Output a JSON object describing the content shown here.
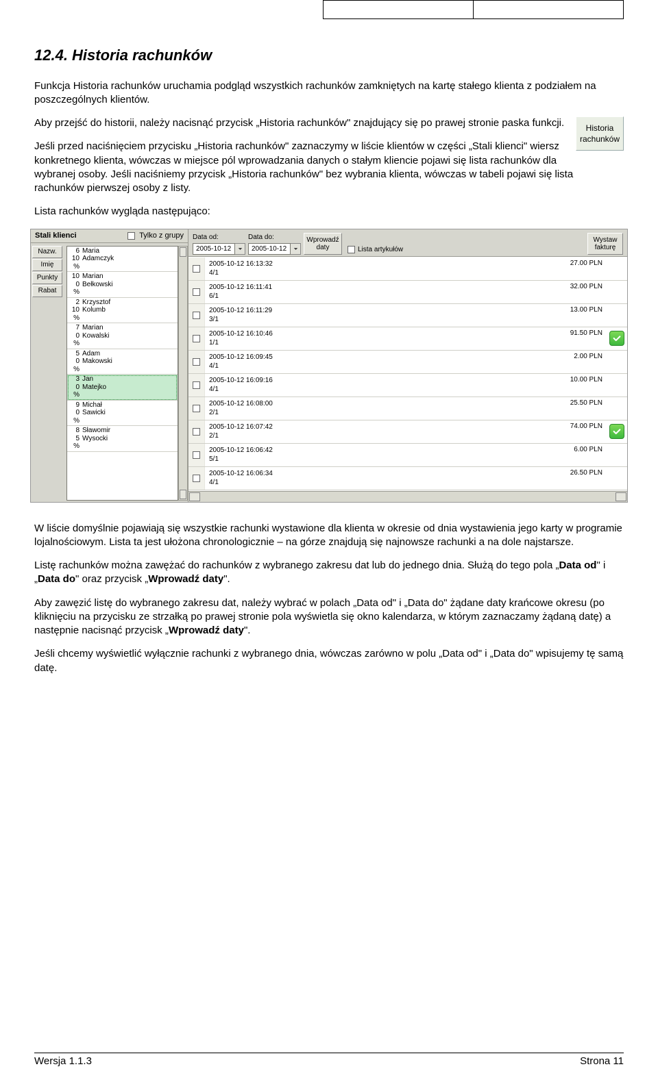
{
  "heading": "12.4. Historia rachunków",
  "paras": {
    "p1": "Funkcja Historia rachunków uruchamia podgląd wszystkich rachunków zamkniętych na kartę stałego klienta z podziałem na poszczególnych klientów.",
    "p2": "Aby przejść do historii, należy nacisnąć przycisk „Historia rachunków\" znajdujący się po prawej stronie paska funkcji.",
    "p3": "Jeśli przed naciśnięciem przycisku „Historia rachunków\" zaznaczymy w liście klientów w części „Stali klienci\" wiersz konkretnego klienta, wówczas w miejsce pól wprowadzania danych o stałym kliencie pojawi się lista rachunków dla wybranej osoby. Jeśli naciśniemy przycisk „Historia rachunków\" bez wybrania klienta, wówczas w tabeli pojawi się lista rachunków pierwszej osoby z listy.",
    "p4": "Lista rachunków wygląda następująco:",
    "p5": "W liście domyślnie pojawiają się wszystkie rachunki wystawione dla klienta w okresie od dnia wystawienia jego karty w programie lojalnościowym. Lista ta jest ułożona chronologicznie – na górze znajdują się najnowsze rachunki a na dole najstarsze.",
    "p6a": "Listę rachunków można zawężać do rachunków z wybranego zakresu dat lub do jednego dnia. Służą do tego pola „",
    "p6b": "Data od",
    "p6c": "\" i „",
    "p6d": "Data do",
    "p6e": "\" oraz przycisk „",
    "p6f": "Wprowadź daty",
    "p6g": "\".",
    "p7a": "Aby zawęzić listę do wybranego zakresu dat, należy wybrać w polach „Data od\" i „Data do\" żądane daty krańcowe okresu (po kliknięciu na przycisku ze strzałką po prawej stronie pola wyświetla się okno kalendarza, w którym zaznaczamy żądaną datę) a następnie nacisnąć przycisk „",
    "p7b": "Wprowadź daty",
    "p7c": "\".",
    "p8": "Jeśli chcemy wyświetlić wyłącznie rachunki z wybranego dnia, wówczas zarówno w polu „Data od\" i „Data do\" wpisujemy tę samą datę."
  },
  "floatButton": "Historia rachunków",
  "screenshot": {
    "left": {
      "header_title": "Stali klienci",
      "header_chk_label": "Tylko z grupy",
      "tabs": [
        "Nazw.",
        "Imię",
        "Punkty",
        "Rabat"
      ],
      "clients": [
        {
          "n": "6",
          "p": "10 %",
          "f": "Maria",
          "l": "Adamczyk"
        },
        {
          "n": "10",
          "p": "0 %",
          "f": "Marian",
          "l": "Bełkowski"
        },
        {
          "n": "2",
          "p": "10 %",
          "f": "Krzysztof",
          "l": "Kolumb"
        },
        {
          "n": "7",
          "p": "0 %",
          "f": "Marian",
          "l": "Kowalski"
        },
        {
          "n": "5",
          "p": "0 %",
          "f": "Adam",
          "l": "Makowski"
        },
        {
          "n": "3",
          "p": "0 %",
          "f": "Jan",
          "l": "Matejko",
          "sel": true
        },
        {
          "n": "9",
          "p": "0 %",
          "f": "Michał",
          "l": "Sawicki"
        },
        {
          "n": "8",
          "p": "5 %",
          "f": "Sławomir",
          "l": "Wysocki"
        }
      ]
    },
    "right": {
      "date_from_lbl": "Data od:",
      "date_to_lbl": "Data do:",
      "date_from": "2005-10-12",
      "date_to": "2005-10-12",
      "apply_btn": "Wprowadź daty",
      "list_articles": "Lista artykułów",
      "issue_btn": "Wystaw fakturę",
      "rows": [
        {
          "ts": "2005-10-12 16:13:32",
          "no": "4/1",
          "amt": "27.00 PLN",
          "ok": false
        },
        {
          "ts": "2005-10-12 16:11:41",
          "no": "6/1",
          "amt": "32.00 PLN",
          "ok": false
        },
        {
          "ts": "2005-10-12 16:11:29",
          "no": "3/1",
          "amt": "13.00 PLN",
          "ok": false
        },
        {
          "ts": "2005-10-12 16:10:46",
          "no": "1/1",
          "amt": "91.50 PLN",
          "ok": true
        },
        {
          "ts": "2005-10-12 16:09:45",
          "no": "4/1",
          "amt": "2.00 PLN",
          "ok": false
        },
        {
          "ts": "2005-10-12 16:09:16",
          "no": "4/1",
          "amt": "10.00 PLN",
          "ok": false
        },
        {
          "ts": "2005-10-12 16:08:00",
          "no": "2/1",
          "amt": "25.50 PLN",
          "ok": false
        },
        {
          "ts": "2005-10-12 16:07:42",
          "no": "2/1",
          "amt": "74.00 PLN",
          "ok": true
        },
        {
          "ts": "2005-10-12 16:06:42",
          "no": "5/1",
          "amt": "6.00 PLN",
          "ok": false
        },
        {
          "ts": "2005-10-12 16:06:34",
          "no": "4/1",
          "amt": "26.50 PLN",
          "ok": false
        }
      ]
    }
  },
  "footer": {
    "left": "Wersja 1.1.3",
    "right": "Strona 11"
  }
}
